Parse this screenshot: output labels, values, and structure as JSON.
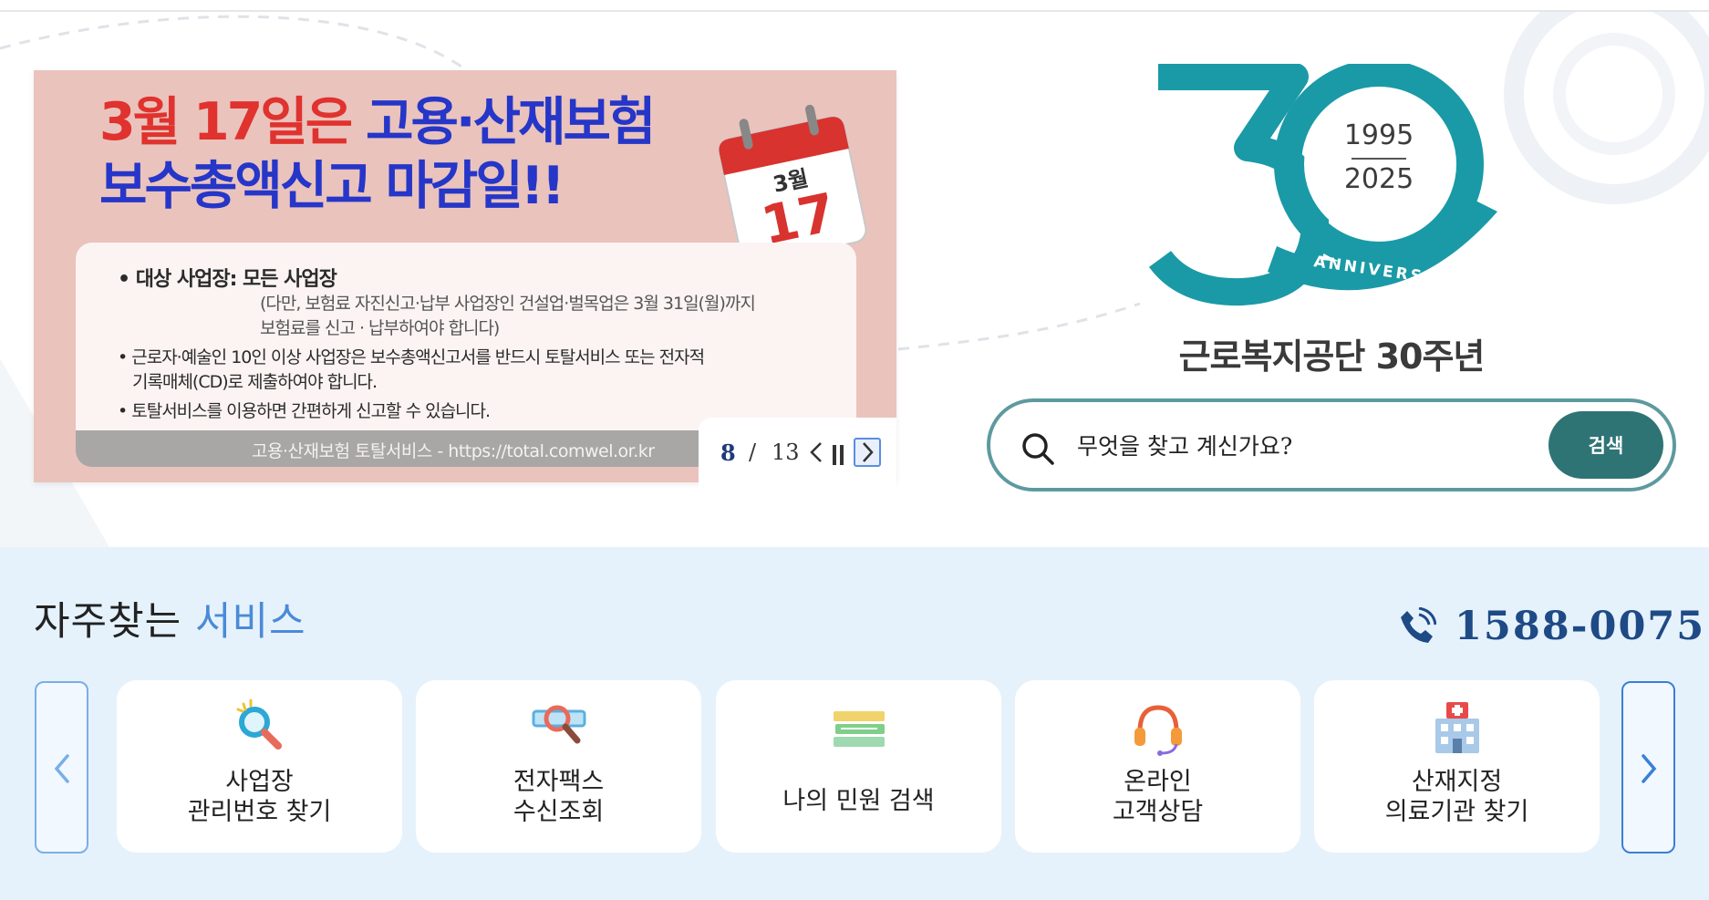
{
  "banner": {
    "title_line1_month": "3월",
    "title_line1_day": "17일은",
    "title_line1_rest": "고용·산재보험",
    "title_line2": "보수총액신고 마감일!!",
    "calendar_month": "3월",
    "calendar_day": "17",
    "bullet1": "• 대상 사업장: 모든 사업장",
    "bullet1_note1": "(다만, 보험료 자진신고·납부 사업장인 건설업·벌목업은 3월 31일(월)까지",
    "bullet1_note2": "보험료를 신고 · 납부하여야 합니다)",
    "bullet2_line1": "• 근로자·예술인 10인 이상 사업장은 보수총액신고서를 반드시 토탈서비스 또는 전자적",
    "bullet2_line2": "기록매체(CD)로 제출하여야 합니다.",
    "bullet3": "• 토탈서비스를 이용하면 간편하게 신고할 수 있습니다.",
    "footer": "고용·산재보험 토탈서비스 - https://total.comwel.or.kr"
  },
  "pager": {
    "current": "8",
    "separator": "/",
    "total": "13"
  },
  "anniversary": {
    "year_start": "1995",
    "year_end": "2025",
    "ribbon_text": "ANNIVERSARY",
    "caption": "근로복지공단 30주년"
  },
  "search": {
    "placeholder": "무엇을 찾고 계신가요?",
    "button_label": "검색"
  },
  "services": {
    "title": "자주찾는",
    "title_accent": "서비스",
    "phone": "1588-0075",
    "cards": [
      {
        "label": "사업장\n관리번호 찾기",
        "icon": "magnifier-icon"
      },
      {
        "label": "전자팩스\n수신조회",
        "icon": "fax-search-icon"
      },
      {
        "label": "나의 민원 검색",
        "icon": "books-icon"
      },
      {
        "label": "온라인\n고객상담",
        "icon": "headset-icon"
      },
      {
        "label": "산재지정\n의료기관 찾기",
        "icon": "hospital-icon"
      }
    ]
  },
  "colors": {
    "brand_teal": "#1a9aa6",
    "search_button": "#2f7475",
    "accent_blue": "#4a8ad8",
    "phone_blue": "#1e4a86",
    "banner_bg": "#eac3bd"
  }
}
